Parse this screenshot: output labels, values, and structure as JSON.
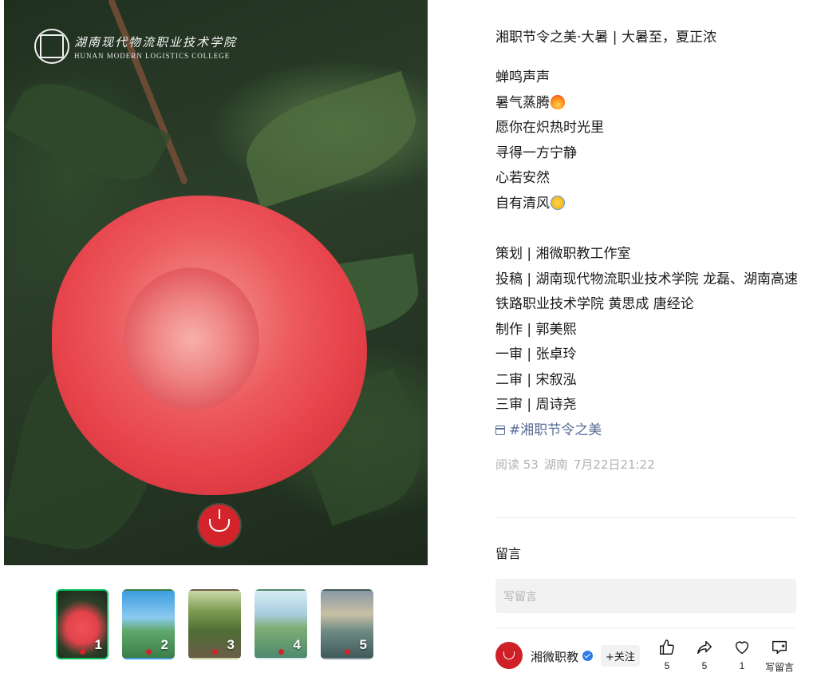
{
  "image": {
    "brand_cn": "湖南现代物流职业技术学院",
    "brand_en": "HUNAN MODERN LOGISTICS COLLEGE"
  },
  "thumbnails": [
    {
      "label": "1",
      "active": true
    },
    {
      "label": "2",
      "active": false
    },
    {
      "label": "3",
      "active": false
    },
    {
      "label": "4",
      "active": false
    },
    {
      "label": "5",
      "active": false
    }
  ],
  "post": {
    "title": "湘职节令之美·大暑 | 大暑至，夏正浓",
    "lines": [
      "蝉鸣声声",
      "暑气蒸腾",
      "愿你在炽热时光里",
      "寻得一方宁静",
      "心若安然",
      "自有清风"
    ],
    "credits": [
      "策划 | 湘微职教工作室",
      "投稿 | 湖南现代物流职业技术学院 龙磊、湖南高速铁路职业技术学院 黄思成 唐经论",
      "制作 | 郭美熙",
      "一审 | 张卓玲",
      "二审 | 宋叙泓",
      "三审 | 周诗尧"
    ],
    "topic": "#湘职节令之美",
    "meta": {
      "reads": "阅读 53",
      "location": "湖南",
      "time": "7月22日21:22"
    }
  },
  "comments": {
    "title": "留言",
    "placeholder": "写留言"
  },
  "footer": {
    "account_name": "湘微职教",
    "follow_label": "+关注",
    "like_count": "5",
    "share_count": "5",
    "fav_count": "1",
    "comment_label": "写留言"
  },
  "colors": {
    "accent_green": "#07c160",
    "link_blue": "#576b95",
    "brand_red": "#d3242b"
  }
}
